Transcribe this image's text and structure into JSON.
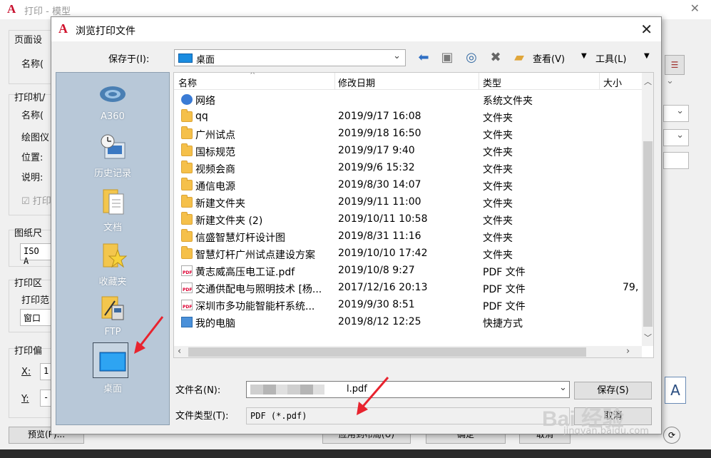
{
  "background": {
    "title": "打印 - 模型",
    "labels": {
      "page_setup": "页面设",
      "name1": "名称(",
      "printer": "打印机/",
      "name2": "名称(",
      "plotter": "绘图仪",
      "location": "位置:",
      "desc": "说明:",
      "print_check": "打印",
      "paper_size": "图纸尺",
      "paper_value": "ISO A",
      "print_area": "打印区",
      "print_range": "打印范",
      "range_value": "窗口",
      "print_offset": "打印偏",
      "x_label": "X:",
      "x_value": "1",
      "y_label": "Y:",
      "y_value": "-",
      "preview_btn": "预览(P)...",
      "apply_btn": "应用到布局(U)",
      "ok_btn": "确定",
      "cancel_btn": "取消"
    }
  },
  "dialog": {
    "title": "浏览打印文件",
    "save_in_label": "保存于(I):",
    "save_in_value": "桌面",
    "toolbar": {
      "view": "查看(V)",
      "tools": "工具(L)"
    },
    "places": [
      {
        "label": "A360",
        "icon": "a360-cloud-icon"
      },
      {
        "label": "历史记录",
        "icon": "history-icon"
      },
      {
        "label": "文档",
        "icon": "documents-icon"
      },
      {
        "label": "收藏夹",
        "icon": "favorites-icon"
      },
      {
        "label": "FTP",
        "icon": "ftp-icon"
      },
      {
        "label": "桌面",
        "icon": "desktop-icon"
      }
    ],
    "columns": {
      "name": "名称",
      "date": "修改日期",
      "type": "类型",
      "size": "大小"
    },
    "files": [
      {
        "name": "网络",
        "date": "",
        "type": "系统文件夹",
        "size": "",
        "icon": "network-icon"
      },
      {
        "name": "qq",
        "date": "2019/9/17 16:08",
        "type": "文件夹",
        "size": "",
        "icon": "folder-icon"
      },
      {
        "name": "广州试点",
        "date": "2019/9/18 16:50",
        "type": "文件夹",
        "size": "",
        "icon": "folder-icon"
      },
      {
        "name": "国标规范",
        "date": "2019/9/17 9:40",
        "type": "文件夹",
        "size": "",
        "icon": "folder-icon"
      },
      {
        "name": "视频会商",
        "date": "2019/9/6 15:32",
        "type": "文件夹",
        "size": "",
        "icon": "folder-icon"
      },
      {
        "name": "通信电源",
        "date": "2019/8/30 14:07",
        "type": "文件夹",
        "size": "",
        "icon": "folder-icon"
      },
      {
        "name": "新建文件夹",
        "date": "2019/9/11 11:00",
        "type": "文件夹",
        "size": "",
        "icon": "folder-icon"
      },
      {
        "name": "新建文件夹 (2)",
        "date": "2019/10/11 10:58",
        "type": "文件夹",
        "size": "",
        "icon": "folder-icon"
      },
      {
        "name": "信盛智慧灯杆设计图",
        "date": "2019/8/31 11:16",
        "type": "文件夹",
        "size": "",
        "icon": "folder-icon"
      },
      {
        "name": "智慧灯杆广州试点建设方案",
        "date": "2019/10/10 17:42",
        "type": "文件夹",
        "size": "",
        "icon": "folder-icon"
      },
      {
        "name": "黄志威高压电工证.pdf",
        "date": "2019/10/8 9:27",
        "type": "PDF 文件",
        "size": "",
        "icon": "pdf-icon"
      },
      {
        "name": "交通供配电与照明技术 [杨...",
        "date": "2017/12/16 20:13",
        "type": "PDF 文件",
        "size": "79,",
        "icon": "pdf-icon"
      },
      {
        "name": "深圳市多功能智能杆系统...",
        "date": "2019/9/30 8:51",
        "type": "PDF 文件",
        "size": "",
        "icon": "pdf-icon"
      },
      {
        "name": "我的电脑",
        "date": "2019/8/12 12:25",
        "type": "快捷方式",
        "size": "",
        "icon": "computer-shortcut-icon"
      }
    ],
    "filename_label": "文件名(N):",
    "filename_value": "l.pdf",
    "filetype_label": "文件类型(T):",
    "filetype_value": "PDF (*.pdf)",
    "save_button": "保存(S)",
    "cancel_button": "取消"
  },
  "watermark": {
    "main": "Bai 经验",
    "sub": "jingyan.baidu.com"
  }
}
